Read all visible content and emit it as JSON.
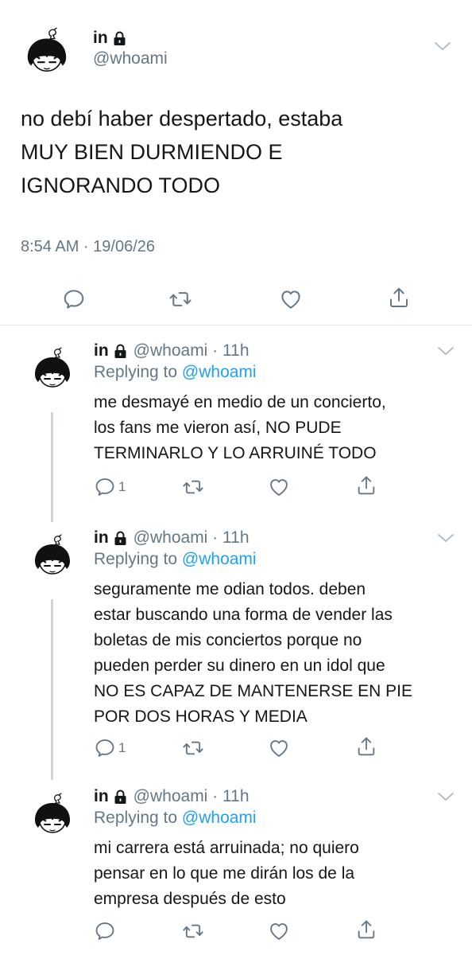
{
  "main_tweet": {
    "display_name": "in",
    "handle": "@whoami",
    "text_lines": [
      "no debí haber despertado, estaba",
      "MUY BIEN DURMIENDO E",
      "IGNORANDO TODO"
    ],
    "timestamp": "8:54 AM · 19/06/26",
    "actions": [
      "reply-icon",
      "retweet-icon",
      "like-icon",
      "share-icon"
    ]
  },
  "replies": [
    {
      "display_name": "in",
      "handle_time": "@whoami · 11h",
      "replying_prefix": "Replying to ",
      "replying_handle": "@whoami",
      "text_lines": [
        "me desmayé en medio de un concierto,",
        "los fans me vieron así, NO PUDE",
        "TERMINARLO Y LO ARRUINÉ TODO"
      ],
      "reply_count": "1"
    },
    {
      "display_name": "in",
      "handle_time": "@whoami · 11h",
      "replying_prefix": "Replying to ",
      "replying_handle": "@whoami",
      "text_lines": [
        "seguramente me odian todos. deben",
        "estar buscando una forma de vender las",
        "boletas de mis conciertos porque no",
        "pueden perder su dinero en un idol que",
        "NO ES CAPAZ DE MANTENERSE EN PIE",
        "POR DOS HORAS Y MEDIA"
      ],
      "reply_count": "1"
    },
    {
      "display_name": "in",
      "handle_time": "@whoami · 11h",
      "replying_prefix": "Replying to ",
      "replying_handle": "@whoami",
      "text_lines": [
        "mi carrera está arruinada; no quiero",
        "pensar en lo que me dirán los de la",
        "empresa después de esto"
      ],
      "reply_count": ""
    }
  ],
  "colors": {
    "text": "#14171a",
    "secondary": "#657786",
    "link": "#1da1f2",
    "divider": "#e1e8ed",
    "thread_line": "#ccd6dd"
  }
}
